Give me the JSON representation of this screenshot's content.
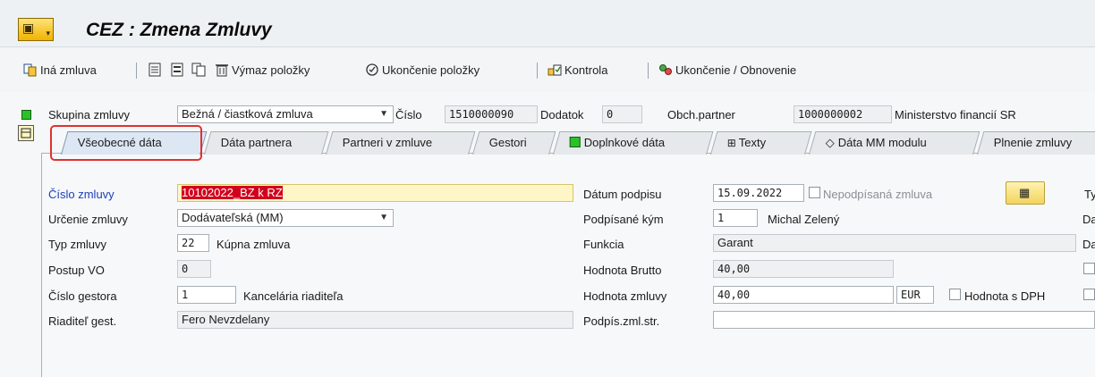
{
  "app": {
    "title": "CEZ : Zmena Zmluvy"
  },
  "toolbar": {
    "other_contract": "Iná zmluva",
    "delete_item": "Výmaz položky",
    "end_item": "Ukončenie položky",
    "check": "Kontrola",
    "end_renew": "Ukončenie / Obnovenie"
  },
  "header": {
    "group_label": "Skupina zmluvy",
    "group_value": "Bežná / čiastková zmluva",
    "number_label": "Číslo",
    "number_value": "1510000090",
    "addendum_label": "Dodatok",
    "addendum_value": "0",
    "partner_label": "Obch.partner",
    "partner_id": "1000000002",
    "partner_name": "Ministerstvo financií SR"
  },
  "tabs": [
    {
      "label": "Všeobecné dáta"
    },
    {
      "label": "Dáta partnera"
    },
    {
      "label": "Partneri v zmluve"
    },
    {
      "label": "Gestori"
    },
    {
      "label": "Doplnkové dáta"
    },
    {
      "label": "Texty"
    },
    {
      "label": "Dáta MM modulu"
    },
    {
      "label": "Plnenie zmluvy"
    }
  ],
  "form": {
    "contract_no_label": "Číslo zmluvy",
    "contract_no_value": "10102022_BZ k RZ",
    "purpose_label": "Určenie zmluvy",
    "purpose_value": "Dodávateľská (MM)",
    "type_label": "Typ zmluvy",
    "type_code": "22",
    "type_text": "Kúpna zmluva",
    "procedure_label": "Postup VO",
    "procedure_value": "0",
    "gestor_no_label": "Číslo gestora",
    "gestor_no_value": "1",
    "gestor_no_text": "Kancelária riaditeľa",
    "gestor_director_label": "Riaditeľ gest.",
    "gestor_director_value": "Fero Nevzdelany",
    "sign_date_label": "Dátum podpisu",
    "sign_date_value": "15.09.2022",
    "unsigned_label": "Nepodpísaná zmluva",
    "signed_by_label": "Podpísané kým",
    "signed_by_code": "1",
    "signed_by_name": "Michal Zelený",
    "function_label": "Funkcia",
    "function_value": "Garant",
    "gross_label": "Hodnota Brutto",
    "gross_value": "40,00",
    "value_label": "Hodnota zmluvy",
    "value_value": "40,00",
    "currency": "EUR",
    "vat_label": "Hodnota s DPH",
    "signer_label": "Podpís.zml.str.",
    "cut_ty": "Ty",
    "cut_da1": "Da",
    "cut_da2": "Da"
  }
}
